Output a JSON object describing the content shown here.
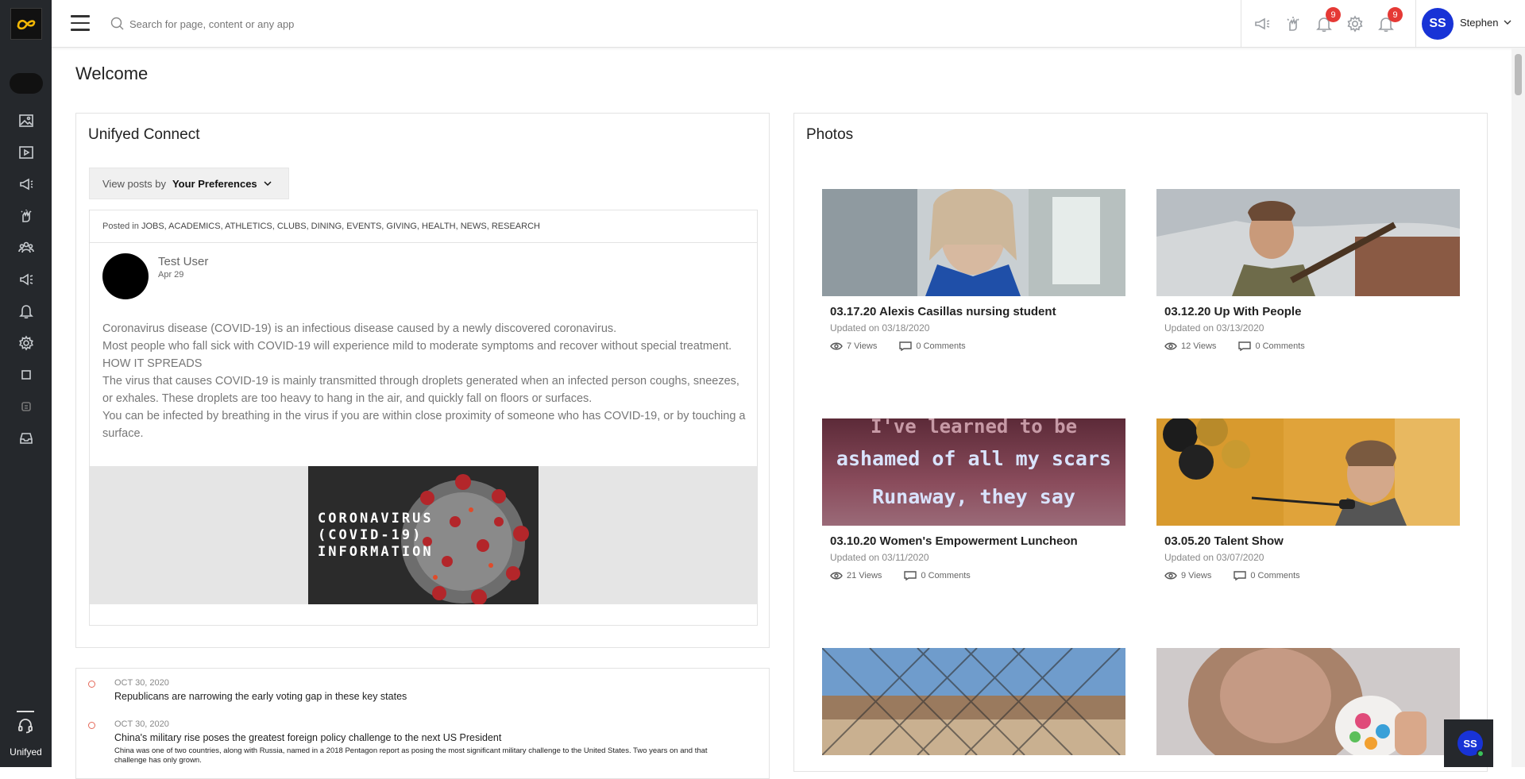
{
  "app": {
    "name": "Unifyed"
  },
  "topbar": {
    "search_placeholder": "Search for page, content or any app",
    "notifications_badge": "9",
    "alerts_badge": "9",
    "avatar_initials": "SS",
    "user_name": "Stephen"
  },
  "page": {
    "title": "Welcome"
  },
  "connect": {
    "title": "Unifyed Connect",
    "view_posts_label": "View posts by",
    "view_posts_value": "Your Preferences",
    "post": {
      "posted_in_label": "Posted in",
      "categories": "JOBS, ACADEMICS, ATHLETICS, CLUBS, DINING, EVENTS, GIVING, HEALTH, NEWS, RESEARCH",
      "author": "Test User",
      "date": "Apr 29",
      "body": [
        "Coronavirus disease (COVID-19) is an infectious disease caused by a newly discovered coronavirus.",
        "Most people who fall sick with COVID-19 will experience mild to moderate symptoms and recover without special treatment.",
        "HOW IT SPREADS",
        "The virus that causes COVID-19 is mainly transmitted through droplets generated when an infected person coughs, sneezes, or exhales. These droplets are too heavy to hang in the air, and quickly fall on floors or surfaces.",
        "You can be infected by breathing in the virus if you are within close proximity of someone who has COVID-19, or by touching a surface."
      ],
      "image_text": [
        "CORONAVIRUS",
        "(COVID-19)",
        "INFORMATION"
      ]
    }
  },
  "news": [
    {
      "date": "OCT 30, 2020",
      "title": "Republicans are narrowing the early voting gap in these key states",
      "desc": ""
    },
    {
      "date": "OCT 30, 2020",
      "title": "China's military rise poses the greatest foreign policy challenge to the next US President",
      "desc": "China was one of two countries, along with Russia, named in a 2018 Pentagon report as posing the most significant military challenge to the United States. Two years on and that challenge has only grown."
    }
  ],
  "photos": {
    "title": "Photos",
    "items": [
      {
        "title": "03.17.20 Alexis Casillas nursing student",
        "updated": "Updated on 03/18/2020",
        "views": "7 Views",
        "comments": "0 Comments"
      },
      {
        "title": "03.12.20 Up With People",
        "updated": "Updated on 03/13/2020",
        "views": "12 Views",
        "comments": "0 Comments"
      },
      {
        "title": "03.10.20 Women's Empowerment Luncheon",
        "updated": "Updated on 03/11/2020",
        "views": "21 Views",
        "comments": "0 Comments"
      },
      {
        "title": "03.05.20 Talent Show",
        "updated": "Updated on 03/07/2020",
        "views": "9 Views",
        "comments": "0 Comments"
      }
    ],
    "banner_text": [
      "I've learned to be",
      "ashamed of all my scars",
      "Runaway, they say"
    ]
  },
  "chat": {
    "initials": "SS"
  },
  "colors": {
    "sidebar": "#25282c",
    "accent": "#1833d6",
    "badge": "#e53935",
    "logo": "#f2b705"
  }
}
